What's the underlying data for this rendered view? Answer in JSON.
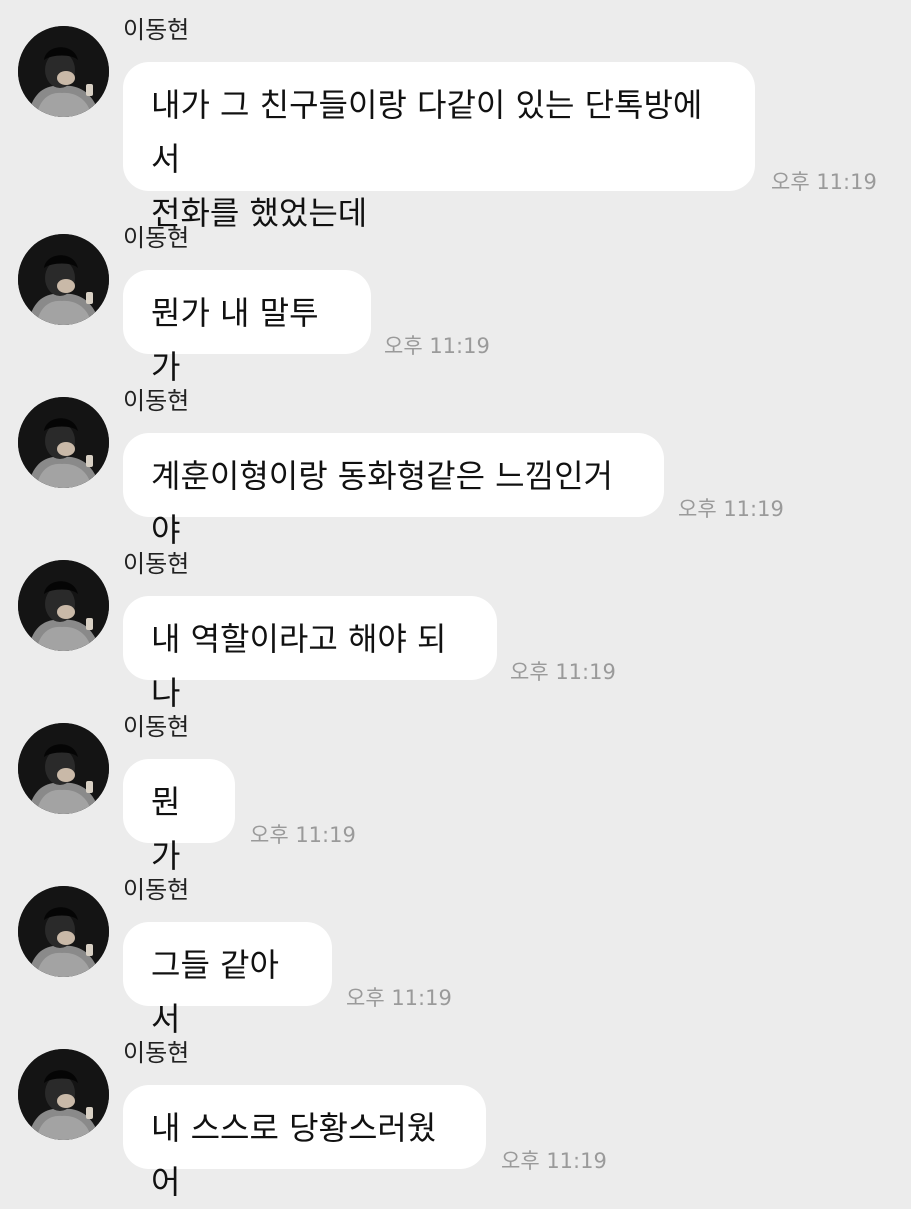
{
  "messages": [
    {
      "sender": "이동현",
      "lines": [
        "내가 그 친구들이랑 다같이 있는 단톡방에서",
        "전화를 했었는데"
      ],
      "time": "오후 11:19"
    },
    {
      "sender": "이동현",
      "lines": [
        "뭔가 내 말투가"
      ],
      "time": "오후 11:19"
    },
    {
      "sender": "이동현",
      "lines": [
        "계훈이형이랑 동화형같은 느낌인거야"
      ],
      "time": "오후 11:19"
    },
    {
      "sender": "이동현",
      "lines": [
        "내 역할이라고 해야 되나"
      ],
      "time": "오후 11:19"
    },
    {
      "sender": "이동현",
      "lines": [
        "뭔가"
      ],
      "time": "오후 11:19"
    },
    {
      "sender": "이동현",
      "lines": [
        "그들 같아서"
      ],
      "time": "오후 11:19"
    },
    {
      "sender": "이동현",
      "lines": [
        "내 스스로 당황스러웠어"
      ],
      "time": "오후 11:19"
    }
  ]
}
